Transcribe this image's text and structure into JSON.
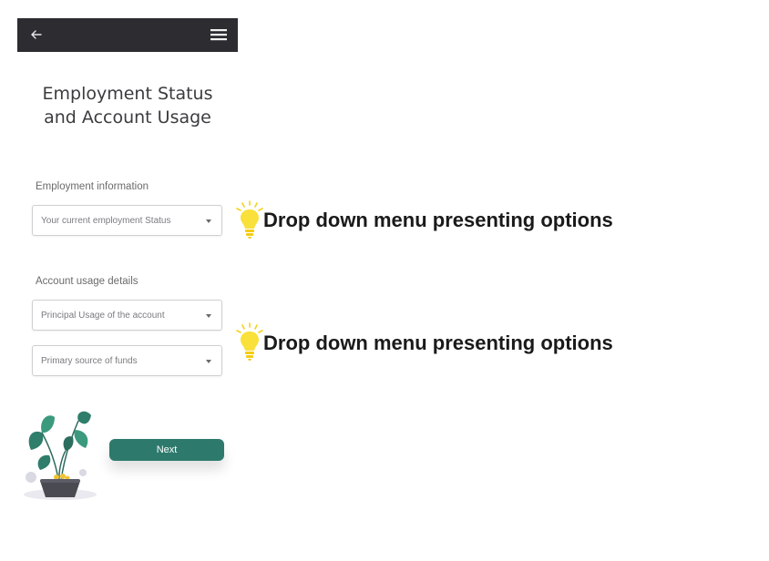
{
  "header": {
    "back_icon": "arrow-left-icon",
    "menu_icon": "hamburger-menu-icon",
    "background_color": "#2c2c31"
  },
  "page": {
    "title_line1": "Employment Status",
    "title_line2": "and Account Usage"
  },
  "employment_section": {
    "label": "Employment information",
    "dropdown_placeholder": "Your current employment Status"
  },
  "account_section": {
    "label": "Account usage details",
    "usage_placeholder": "Principal Usage of the account",
    "funds_placeholder": "Primary source of funds"
  },
  "actions": {
    "next_label": "Next",
    "accent_color": "#2d7a6c"
  },
  "annotations": [
    {
      "text": "Drop down menu presenting options",
      "icon": "lightbulb-icon"
    },
    {
      "text": "Drop down menu presenting options",
      "icon": "lightbulb-icon"
    }
  ]
}
